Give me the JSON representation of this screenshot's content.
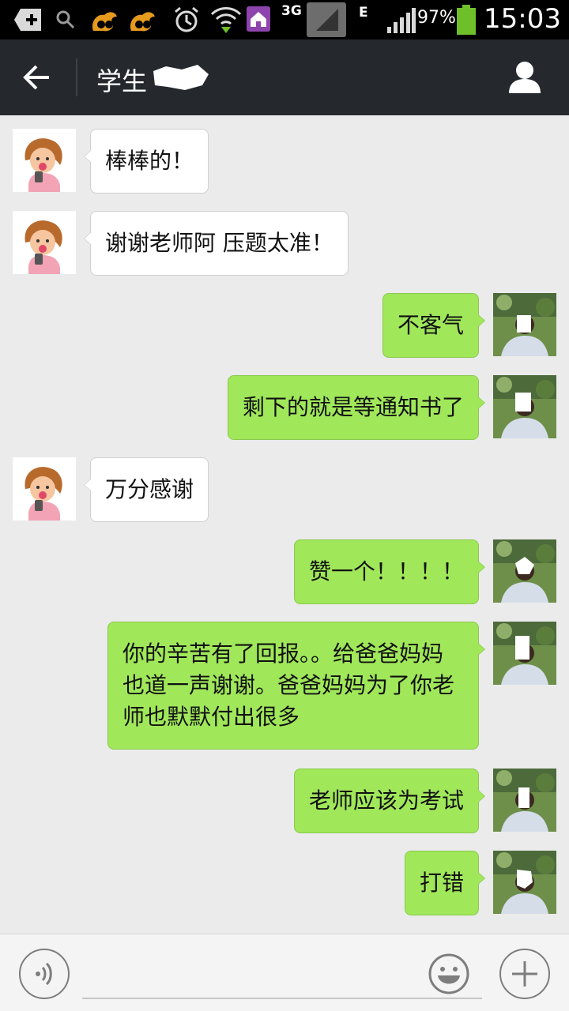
{
  "status_bar": {
    "network": "3G",
    "network2": "E",
    "battery": "97%",
    "time": "15:03",
    "icons": [
      "add-box-icon",
      "search-icon",
      "uc-browser-icon",
      "uc-browser-icon",
      "alarm-icon",
      "wifi-icon",
      "home-app-icon",
      "signal-icon",
      "signal-icon",
      "battery-icon"
    ]
  },
  "header": {
    "title": "学生",
    "back_icon": "back-arrow-icon",
    "profile_icon": "person-icon"
  },
  "messages": [
    {
      "side": "in",
      "text": "棒棒的！"
    },
    {
      "side": "in",
      "text": "谢谢老师阿 压题太准！"
    },
    {
      "side": "out",
      "text": "不客气"
    },
    {
      "side": "out",
      "text": "剩下的就是等通知书了"
    },
    {
      "side": "in",
      "text": "万分感谢"
    },
    {
      "side": "out",
      "text": "赞一个！！！！"
    },
    {
      "side": "out",
      "text": "你的辛苦有了回报。。给爸爸妈妈也道一声谢谢。爸爸妈妈为了你老师也默默付出很多"
    },
    {
      "side": "out",
      "text": "老师应该为考试"
    },
    {
      "side": "out",
      "text": "打错"
    }
  ],
  "input_bar": {
    "voice_icon": "voice-icon",
    "emoji_icon": "emoji-icon",
    "plus_icon": "plus-icon",
    "text_value": ""
  },
  "colors": {
    "title_bar": "#25292e",
    "chat_bg": "#ebebeb",
    "outgoing_bubble": "#a0e75a",
    "incoming_bubble": "#ffffff"
  }
}
